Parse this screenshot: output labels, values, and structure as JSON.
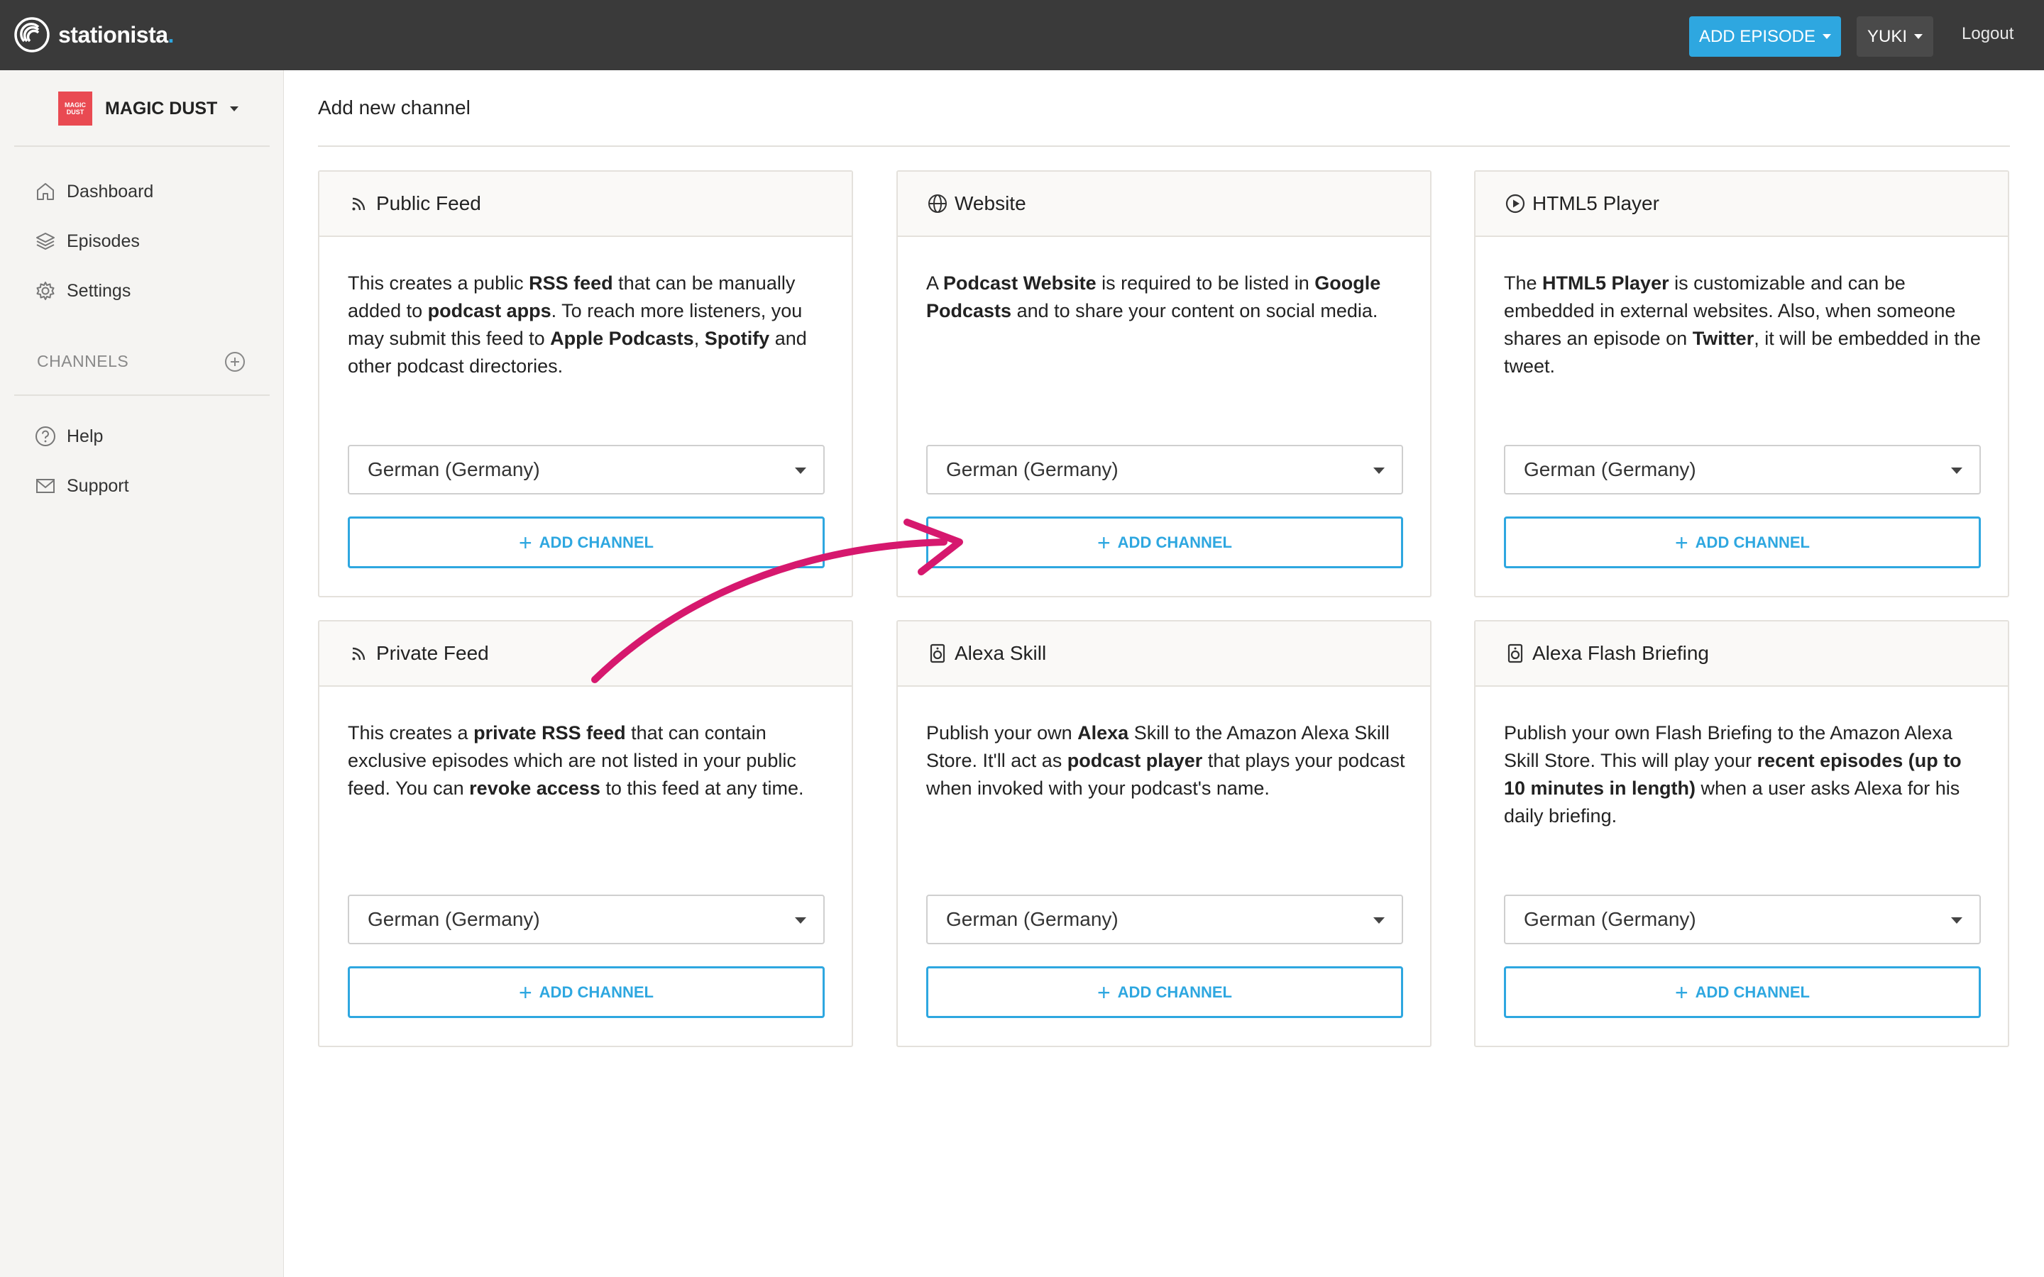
{
  "topbar": {
    "brand": "stationista",
    "brand_dot": ".",
    "add_episode_label": "ADD EPISODE",
    "user_label": "YUKI",
    "logout_label": "Logout"
  },
  "sidebar": {
    "podcast_thumb_text": "MAGIC DUST",
    "podcast_name": "MAGIC DUST",
    "nav": [
      {
        "label": "Dashboard",
        "icon": "home-icon"
      },
      {
        "label": "Episodes",
        "icon": "layers-icon"
      },
      {
        "label": "Settings",
        "icon": "gear-icon"
      }
    ],
    "channels_label": "CHANNELS",
    "help": [
      {
        "label": "Help",
        "icon": "help-circle-icon"
      },
      {
        "label": "Support",
        "icon": "mail-icon"
      }
    ]
  },
  "main": {
    "title": "Add new channel",
    "cards": [
      {
        "title": "Public Feed",
        "icon": "rss-icon",
        "desc": "This creates a public <b>RSS feed</b> that can be manually added to <b>podcast apps</b>. To reach more listeners, you may submit this feed to <b>Apple Podcasts</b>, <b>Spotify</b> and other podcast directories.",
        "language": "German (Germany)",
        "button": "ADD CHANNEL"
      },
      {
        "title": "Website",
        "icon": "globe-icon",
        "desc": "A <b>Podcast Website</b> is required to be listed in <b>Google Podcasts</b> and to share your content on social media.",
        "language": "German (Germany)",
        "button": "ADD CHANNEL"
      },
      {
        "title": "HTML5 Player",
        "icon": "play-circle-icon",
        "desc": "The <b>HTML5 Player</b> is customizable and can be embedded in external websites. Also, when someone shares an episode on <b>Twitter</b>, it will be embedded in the tweet.",
        "language": "German (Germany)",
        "button": "ADD CHANNEL"
      },
      {
        "title": "Private Feed",
        "icon": "rss-icon",
        "desc": "This creates a <b>private RSS feed</b> that can contain exclusive episodes which are not listed in your public feed. You can <b>revoke access</b> to this feed at any time.",
        "language": "German (Germany)",
        "button": "ADD CHANNEL"
      },
      {
        "title": "Alexa Skill",
        "icon": "speaker-icon",
        "desc": "Publish your own <b>Alexa</b> Skill to the Amazon Alexa Skill Store. It'll act as <b>podcast player</b> that plays your podcast when invoked with your podcast's name.",
        "language": "German (Germany)",
        "button": "ADD CHANNEL"
      },
      {
        "title": "Alexa Flash Briefing",
        "icon": "speaker-icon",
        "desc": "Publish your own Flash Briefing to the Amazon Alexa Skill Store. This will play your <b>recent episodes (up to 10 minutes in length)</b> when a user asks Alexa for his daily briefing.",
        "language": "German (Germany)",
        "button": "ADD CHANNEL"
      }
    ]
  },
  "colors": {
    "accent": "#2ea7e0",
    "topbar": "#3a3a3a",
    "annotation_arrow": "#d6186e"
  }
}
